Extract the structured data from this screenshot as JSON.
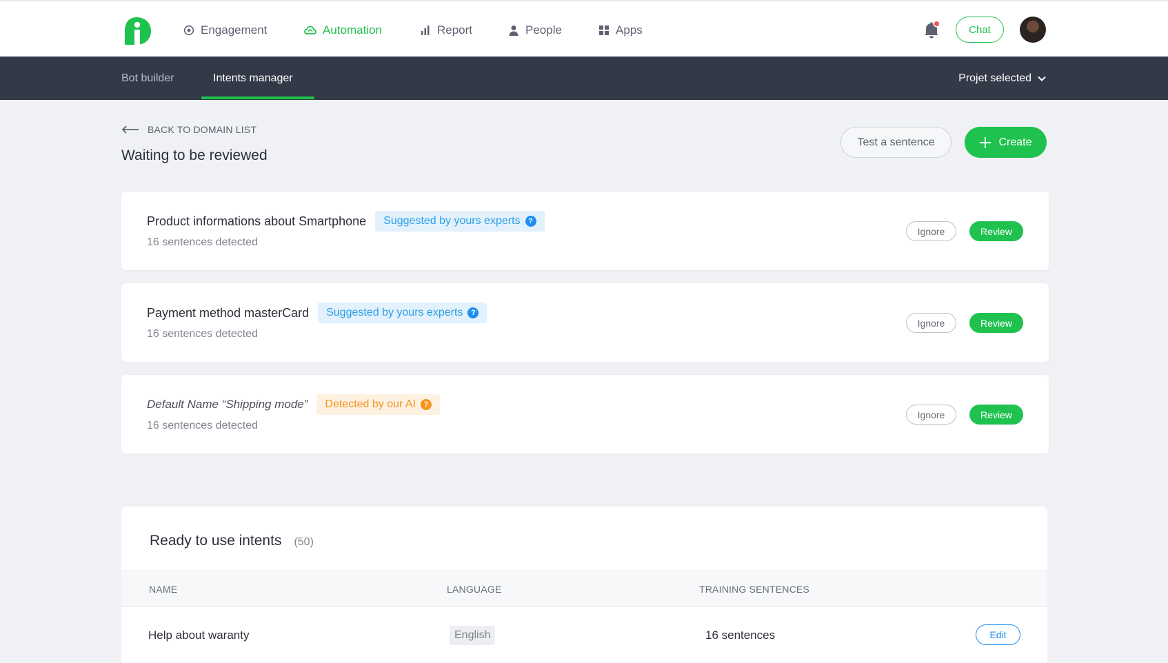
{
  "nav": {
    "items": [
      {
        "label": "Engagement",
        "icon": "target-icon"
      },
      {
        "label": "Automation",
        "icon": "cloud-icon",
        "active": true
      },
      {
        "label": "Report",
        "icon": "bar-chart-icon"
      },
      {
        "label": "People",
        "icon": "person-icon"
      },
      {
        "label": "Apps",
        "icon": "grid-icon"
      }
    ],
    "chat_label": "Chat"
  },
  "subnav": {
    "tabs": [
      {
        "label": "Bot builder"
      },
      {
        "label": "Intents manager",
        "active": true
      }
    ],
    "project_label": "Projet selected"
  },
  "header": {
    "back_label": "BACK TO DOMAIN LIST",
    "title": "Waiting to be reviewed",
    "test_label": "Test a sentence",
    "create_label": "Create"
  },
  "pending": [
    {
      "name": "Product informations about Smartphone",
      "badge": "Suggested by yours experts",
      "badge_type": "expert",
      "sub": "16 sentences detected",
      "ignore": "Ignore",
      "review": "Review"
    },
    {
      "name": "Payment method masterCard",
      "badge": "Suggested by yours experts",
      "badge_type": "expert",
      "sub": "16 sentences detected",
      "ignore": "Ignore",
      "review": "Review"
    },
    {
      "name": "Default Name “Shipping mode”",
      "badge": "Detected by our AI",
      "badge_type": "ai",
      "sub": "16 sentences detected",
      "ignore": "Ignore",
      "review": "Review"
    }
  ],
  "ready": {
    "title": "Ready to use intents",
    "count": "(50)",
    "columns": [
      "NAME",
      "LANGUAGE",
      "TRAINING SENTENCES"
    ],
    "rows": [
      {
        "name": "Help about waranty",
        "language": "English",
        "training": "16 sentences",
        "action": "Edit"
      }
    ]
  },
  "colors": {
    "accent_green": "#1fc24f",
    "subnav_bg": "#343948",
    "expert_blue": "#2a9fe8",
    "ai_orange": "#f5941f"
  }
}
